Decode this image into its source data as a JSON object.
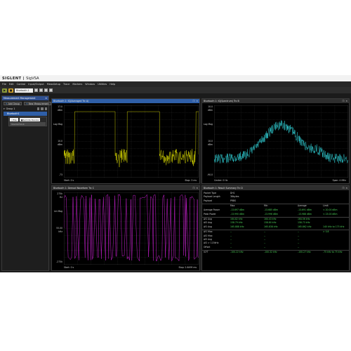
{
  "app": {
    "brand": "SIGLENT",
    "name": "SigVSA"
  },
  "menu": [
    "File",
    "Edit",
    "Control",
    "Input/Output",
    "MeasSetup",
    "Trace",
    "Markers",
    "Window",
    "Utilities",
    "Help"
  ],
  "toolbar": {
    "play_icon": "play-icon",
    "stop_icon": "stop-icon",
    "selector_value": "Bluetooth 1"
  },
  "sidebar": {
    "title": "Measurement Management",
    "add_group": "Add Group",
    "new_measurement": "New Measurement",
    "group_name": "Group 1",
    "selected_measurement": "Bluetooth1",
    "file_label": "File",
    "remote_device": "Remote Device",
    "device_field": "SSA3075X-R"
  },
  "panels": {
    "p1": {
      "title": "Bluetooth 1: IQ(Averaged Trc A)",
      "y_labels": [
        "17.0",
        "dBm",
        "Log Mag",
        "10.0",
        "dBm",
        "-73"
      ],
      "start": "Start: 0 s",
      "stop": "Stop: 3 ms",
      "color": "#f2f200"
    },
    "p2": {
      "title": "Bluetooth 1: IQ(Spectrum) Trc B",
      "y_labels": [
        "10.0",
        "dBm",
        "Log Mag",
        "10.0",
        "dBm",
        "-90.0"
      ],
      "center": "Center: 0 Hz",
      "span": "Span: 4 MHz",
      "color": "#33e0e6"
    },
    "p3": {
      "title": "Bluetooth 1: Demod Waveform Trc C",
      "y_labels": [
        "275k",
        "Hz",
        "Lin Mag",
        "55.00",
        "kHz",
        "-275k"
      ],
      "start": "Start: 0 s",
      "stop": "Stop: 2.6499 ms",
      "color": "#d020d8"
    },
    "p4": {
      "title": "Bluetooth 1: Result Summary Trc D"
    }
  },
  "summary": {
    "info": [
      {
        "label": "Packet Type",
        "value": "DH1"
      },
      {
        "label": "Payload Length",
        "value": "36bytes"
      },
      {
        "label": "Payload",
        "value": "PRBS"
      }
    ],
    "header": [
      "",
      "Max",
      "Min",
      "Average",
      "Limit"
    ],
    "rows": [
      {
        "label": "Average Power",
        "values": [
          "-13.697 dBm",
          "-13.685 dBm",
          "-13.691 dBm",
          "< 20.00 dBm"
        ]
      },
      {
        "label": "Peak Power",
        "values": [
          "-13.990 dBm",
          "-13.996 dBm",
          "-13.988 dBm",
          "< 23.00 dBm"
        ]
      },
      {
        "label": "Δf1 Avg",
        "values": [
          "164.82 kHz",
          "164.43 kHz",
          "164.56 kHz",
          ""
        ]
      },
      {
        "label": "Δf2 Avg",
        "values": [
          "158.79 kHz",
          "158.80 kHz",
          "158.73 kHz",
          ""
        ]
      },
      {
        "label": "Δf1 Avg",
        "values": [
          "165.888 kHz",
          "165.838 kHz",
          "165.862 kHz",
          "140 kHz to 175 kHz"
        ]
      },
      {
        "label": "Δf1 Max",
        "values": [
          "--",
          "--",
          "--",
          "> 0.8"
        ]
      },
      {
        "label": "Δf2 Max",
        "values": [
          "--",
          "--",
          "--",
          ""
        ]
      },
      {
        "label": "Δf2 Avg",
        "values": [
          "--",
          "--",
          "--",
          ""
        ]
      },
      {
        "label": "Δf2 > 115kHz",
        "values": [
          "--",
          "--",
          "--",
          ""
        ]
      },
      {
        "label": "Offset",
        "values": [
          "--",
          "--",
          "--",
          ""
        ]
      },
      {
        "label": "ICFT",
        "values": [
          "-100.22 kHz",
          "-100.32 kHz",
          "-100.27 kHz",
          "-75 kHz to 75 kHz"
        ]
      }
    ]
  }
}
